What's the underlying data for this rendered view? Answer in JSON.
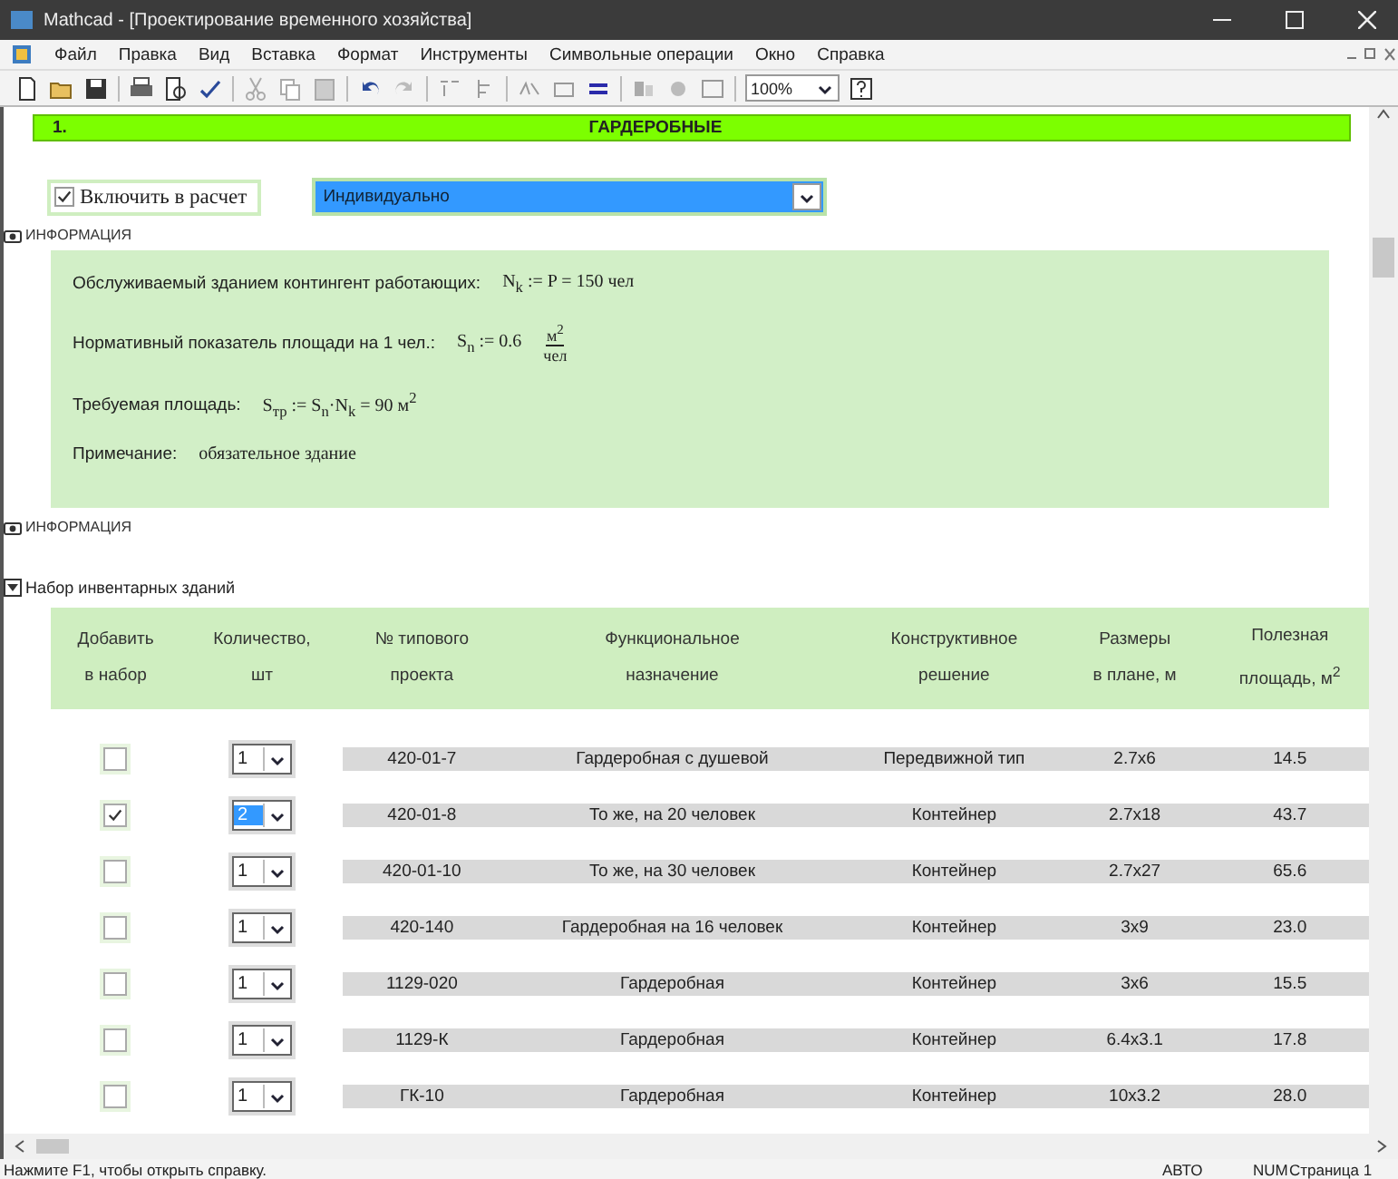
{
  "window": {
    "title": "Mathcad - [Проектирование временного хозяйства]"
  },
  "menu": [
    "Файл",
    "Правка",
    "Вид",
    "Вставка",
    "Формат",
    "Инструменты",
    "Символьные операции",
    "Окно",
    "Справка"
  ],
  "toolbar": {
    "zoom": "100%"
  },
  "section": {
    "number": "1.",
    "title": "ГАРДЕРОБНЫЕ"
  },
  "include": {
    "label": "Включить в расчет",
    "checked": true
  },
  "mode_dropdown": {
    "value": "Индивидуально"
  },
  "info_top": {
    "label": "ИНФОРМАЦИЯ"
  },
  "info_panel": {
    "lines": [
      {
        "kind": "plain",
        "label": "Обслуживаемый зданием контингент работающих:",
        "formula": "N$_{k}$ := P = 150 чел"
      },
      {
        "kind": "fraction",
        "label": "Нормативный показатель площади на 1 чел.:",
        "formula": "S$_{n}$ := 0.6",
        "numerator": "м$^{2}$",
        "denominator": "чел"
      },
      {
        "kind": "plain",
        "label": "Требуемая площадь:",
        "formula": "S$_{тр}$ := S$_{n}$·N$_{k}$ = 90 м$^{2}$"
      },
      {
        "kind": "plain",
        "label": "Примечание:",
        "formula": "обязательное здание"
      }
    ]
  },
  "info_bottom": {
    "label": "ИНФОРМАЦИЯ"
  },
  "set": {
    "label": "Набор инвентарных зданий",
    "expanded": true
  },
  "table": {
    "columns": [
      "Добавить\nв набор",
      "Количество,\nшт",
      "№ типового\nпроекта",
      "Функциональное\nназначение",
      "Конструктивное\nрешение",
      "Размеры\nв плане, м",
      "Полезная\nплощадь, м$^{2}$"
    ],
    "rows": [
      {
        "checked": false,
        "quantity": "1",
        "quantity_selected": false,
        "project": "420-01-7",
        "purpose": "Гардеробная с душевой",
        "construction": "Передвижной тип",
        "size": "2.7x6",
        "area": "14.5"
      },
      {
        "checked": true,
        "quantity": "2",
        "quantity_selected": true,
        "project": "420-01-8",
        "purpose": "То же, на 20 человек",
        "construction": "Контейнер",
        "size": "2.7x18",
        "area": "43.7"
      },
      {
        "checked": false,
        "quantity": "1",
        "quantity_selected": false,
        "project": "420-01-10",
        "purpose": "То же, на 30 человек",
        "construction": "Контейнер",
        "size": "2.7x27",
        "area": "65.6"
      },
      {
        "checked": false,
        "quantity": "1",
        "quantity_selected": false,
        "project": "420-140",
        "purpose": "Гардеробная на 16 человек",
        "construction": "Контейнер",
        "size": "3x9",
        "area": "23.0"
      },
      {
        "checked": false,
        "quantity": "1",
        "quantity_selected": false,
        "project": "1129-020",
        "purpose": "Гардеробная",
        "construction": "Контейнер",
        "size": "3x6",
        "area": "15.5"
      },
      {
        "checked": false,
        "quantity": "1",
        "quantity_selected": false,
        "project": "1129-К",
        "purpose": "Гардеробная",
        "construction": "Контейнер",
        "size": "6.4x3.1",
        "area": "17.8"
      },
      {
        "checked": false,
        "quantity": "1",
        "quantity_selected": false,
        "project": "ГК-10",
        "purpose": "Гардеробная",
        "construction": "Контейнер",
        "size": "10x3.2",
        "area": "28.0"
      }
    ]
  },
  "status_bar": {
    "hint": "Нажмите F1, чтобы открыть справку.",
    "mode": "АВТО",
    "num": "NUM",
    "page": "Страница 1"
  }
}
